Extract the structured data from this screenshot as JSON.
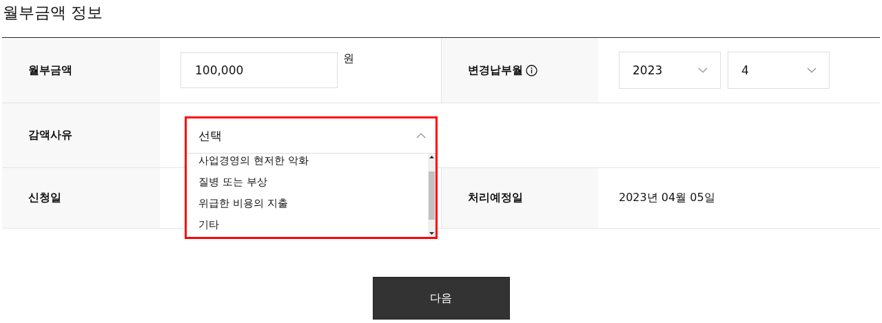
{
  "section_title": "월부금액 정보",
  "rows": [
    {
      "fields": [
        {
          "label": "월부금액",
          "kind": "amount",
          "value": "100,000",
          "unit": "원"
        },
        {
          "label": "변경납부월",
          "kind": "month",
          "info": true,
          "selects": [
            "2023",
            "4"
          ]
        }
      ]
    },
    {
      "fields": [
        {
          "label": "감액사유",
          "kind": "dropdown"
        }
      ]
    },
    {
      "fields": [
        {
          "label": "신청일",
          "kind": "text"
        },
        {
          "label": "처리예정일",
          "kind": "text",
          "value": "2023년 04월 05일"
        }
      ]
    }
  ],
  "dropdown": {
    "selected_text": "선택",
    "expanded": true,
    "highlighted": true,
    "options": [
      "사업경영의 현저한 악화",
      "질병 또는 부상",
      "위급한 비용의 지출",
      "기타"
    ]
  },
  "next_button": "다음"
}
